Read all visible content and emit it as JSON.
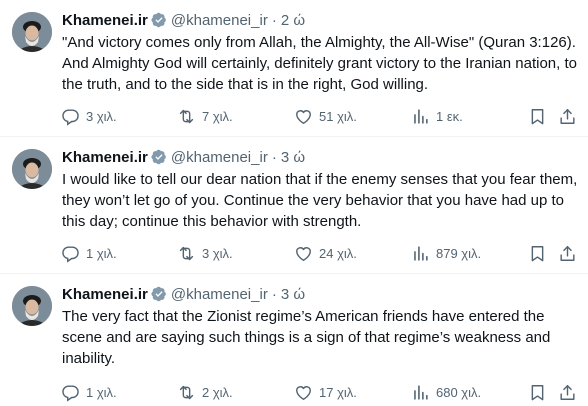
{
  "tweets": [
    {
      "name": "Khamenei.ir",
      "handle": "@khamenei_ir",
      "dot": "·",
      "time": "2 ώ",
      "text": "\"And victory comes only from Allah, the Almighty, the All-Wise\" (Quran 3:126). And Almighty God will certainly, definitely grant victory to the Iranian nation, to the truth, and to the side that is in the right, God willing.",
      "replies": "3 χιλ.",
      "reposts": "7 χιλ.",
      "likes": "51 χιλ.",
      "views": "1 εκ."
    },
    {
      "name": "Khamenei.ir",
      "handle": "@khamenei_ir",
      "dot": "·",
      "time": "3 ώ",
      "text": "I would like to tell our dear nation that if the enemy senses that you fear them, they won’t let go of you. Continue the very behavior that you have had up to this day; continue this behavior with strength.",
      "replies": "1 χιλ.",
      "reposts": "3 χιλ.",
      "likes": "24 χιλ.",
      "views": "879 χιλ."
    },
    {
      "name": "Khamenei.ir",
      "handle": "@khamenei_ir",
      "dot": "·",
      "time": "3 ώ",
      "text": "The very fact that the Zionist regime’s American friends have entered the scene and are saying such things is a sign of that regime’s weakness and inability.",
      "replies": "1 χιλ.",
      "reposts": "2 χιλ.",
      "likes": "17 χιλ.",
      "views": "680 χιλ."
    }
  ],
  "icons": {
    "reply": "reply-icon",
    "repost": "repost-icon",
    "like": "like-icon",
    "views": "views-icon",
    "bookmark": "bookmark-icon",
    "share": "share-icon",
    "verified": "verified-badge-icon"
  },
  "colors": {
    "text": "#0f1419",
    "secondary": "#536471",
    "verified": "#829aab",
    "divider": "#eff3f4"
  }
}
